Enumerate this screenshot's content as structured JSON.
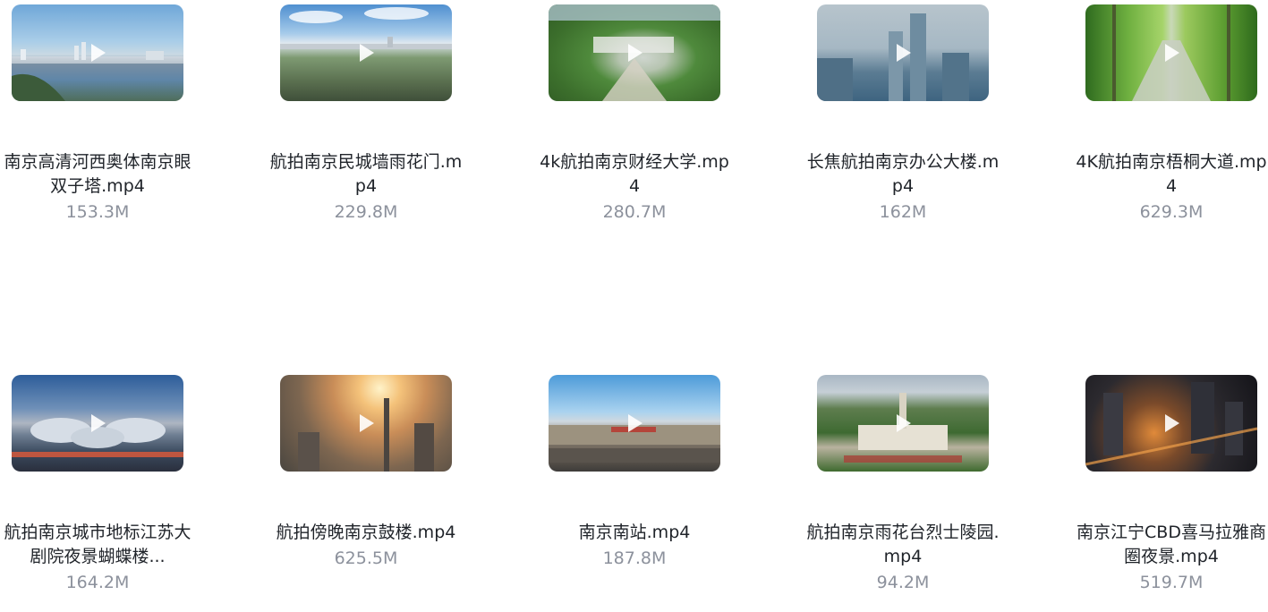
{
  "files": [
    {
      "name": "南京高清河西奥体南京眼双子塔.mp4",
      "size": "153.3M",
      "thumb": "river"
    },
    {
      "name": "航拍南京民城墙雨花门.mp4",
      "size": "229.8M",
      "thumb": "city"
    },
    {
      "name": "4k航拍南京财经大学.mp4",
      "size": "280.7M",
      "thumb": "campus"
    },
    {
      "name": "长焦航拍南京办公大楼.mp4",
      "size": "162M",
      "thumb": "towers"
    },
    {
      "name": "4K航拍南京梧桐大道.mp4",
      "size": "629.3M",
      "thumb": "trees"
    },
    {
      "name": "航拍南京城市地标江苏大剧院夜景蝴蝶楼...",
      "size": "164.2M",
      "thumb": "theater"
    },
    {
      "name": "航拍傍晚南京鼓楼.mp4",
      "size": "625.5M",
      "thumb": "sunset"
    },
    {
      "name": "南京南站.mp4",
      "size": "187.8M",
      "thumb": "station"
    },
    {
      "name": "航拍南京雨花台烈士陵园.mp4",
      "size": "94.2M",
      "thumb": "memorial"
    },
    {
      "name": "南京江宁CBD喜马拉雅商圈夜景.mp4",
      "size": "519.7M",
      "thumb": "night"
    }
  ],
  "icons": {
    "play": "play-icon"
  },
  "colors": {
    "title": "#1f2329",
    "size": "#8c919c",
    "play_overlay": "#ffffff"
  }
}
